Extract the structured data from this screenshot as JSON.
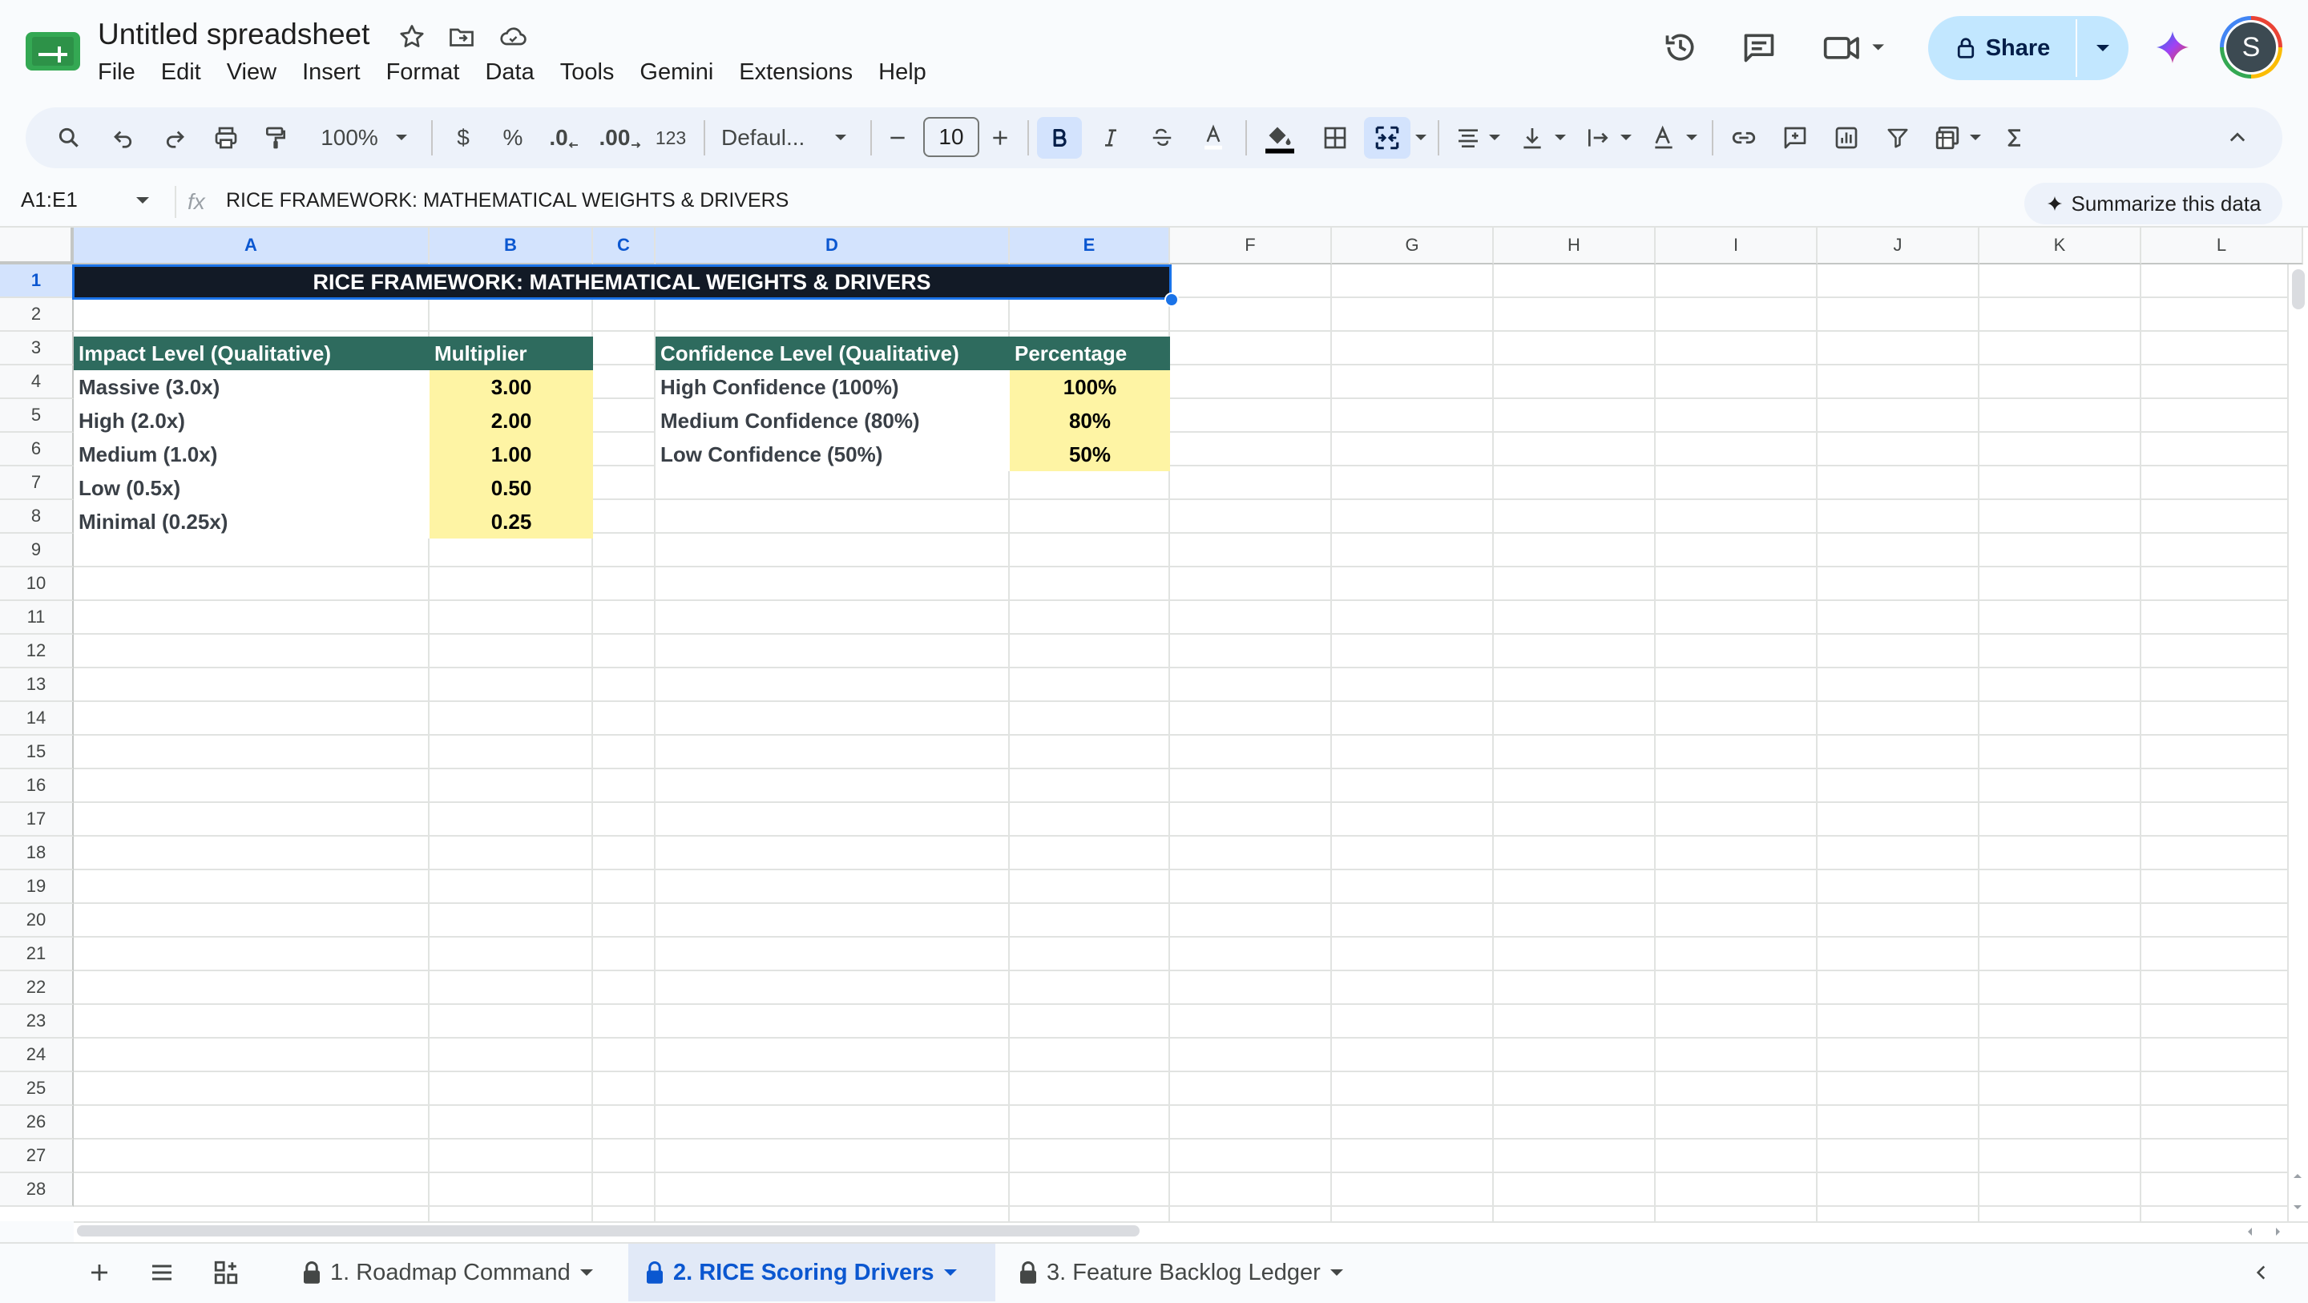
{
  "app": {
    "title": "Untitled spreadsheet",
    "menu": [
      "File",
      "Edit",
      "View",
      "Insert",
      "Format",
      "Data",
      "Tools",
      "Gemini",
      "Extensions",
      "Help"
    ],
    "share_label": "Share",
    "avatar_letter": "S"
  },
  "toolbar": {
    "zoom": "100%",
    "currency": "$",
    "percent": "%",
    "decrease_decimal": ".0",
    "increase_decimal": ".00",
    "number_format": "123",
    "font": "Defaul...",
    "font_size": "10"
  },
  "formula_bar": {
    "name_box": "A1:E1",
    "fx": "fx",
    "content": "RICE FRAMEWORK: MATHEMATICAL WEIGHTS & DRIVERS",
    "summarize": "Summarize this data"
  },
  "columns": [
    "A",
    "B",
    "C",
    "D",
    "E",
    "F",
    "G",
    "H",
    "I",
    "J",
    "K",
    "L"
  ],
  "rows": [
    "1",
    "2",
    "3",
    "4",
    "5",
    "6",
    "7",
    "8",
    "9",
    "10",
    "11",
    "12",
    "13",
    "14",
    "15",
    "16",
    "17",
    "18",
    "19",
    "20",
    "21",
    "22",
    "23",
    "24",
    "25",
    "26",
    "27",
    "28"
  ],
  "sheet": {
    "title": "RICE FRAMEWORK: MATHEMATICAL WEIGHTS & DRIVERS",
    "impact_table": {
      "headers": [
        "Impact Level (Qualitative)",
        "Multiplier"
      ],
      "rows": [
        [
          "Massive (3.0x)",
          "3.00"
        ],
        [
          "High (2.0x)",
          "2.00"
        ],
        [
          "Medium (1.0x)",
          "1.00"
        ],
        [
          "Low (0.5x)",
          "0.50"
        ],
        [
          "Minimal (0.25x)",
          "0.25"
        ]
      ]
    },
    "confidence_table": {
      "headers": [
        "Confidence Level (Qualitative)",
        "Percentage"
      ],
      "rows": [
        [
          "High Confidence (100%)",
          "100%"
        ],
        [
          "Medium Confidence (80%)",
          "80%"
        ],
        [
          "Low Confidence (50%)",
          "50%"
        ]
      ]
    }
  },
  "tabs": [
    "1. Roadmap Command",
    "2. RICE Scoring Drivers",
    "3. Feature Backlog Ledger"
  ],
  "colors": {
    "header_green": "#2e6b5e",
    "title_navy": "#121a26",
    "value_yellow": "#fef4a4",
    "accent_blue": "#0b57d0"
  }
}
